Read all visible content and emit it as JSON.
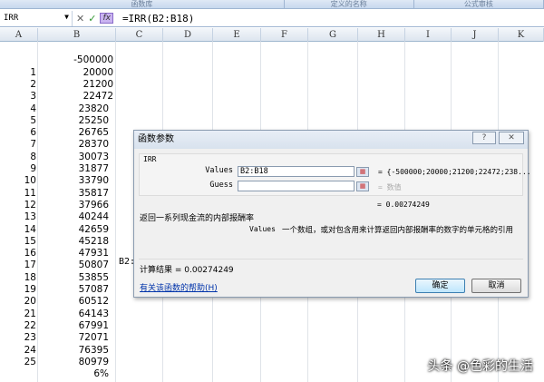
{
  "ribbon": {
    "groups": [
      "函数库",
      "定义的名称",
      "公式审核"
    ]
  },
  "formula_bar": {
    "name_box": "IRR",
    "formula": "=IRR(B2:B18)",
    "fx": "fx",
    "cancel": "✕",
    "enter": "✓"
  },
  "columns": [
    "A",
    "B",
    "C",
    "D",
    "E",
    "F",
    "G",
    "H",
    "I",
    "J",
    "K"
  ],
  "rows": [
    {
      "a": "",
      "b": ""
    },
    {
      "a": "",
      "b": "-500000"
    },
    {
      "a": "1",
      "b": "20000"
    },
    {
      "a": "2",
      "b": "21200"
    },
    {
      "a": "3",
      "b": "22472"
    },
    {
      "a": "4",
      "b": "23820"
    },
    {
      "a": "5",
      "b": "25250"
    },
    {
      "a": "6",
      "b": "26765"
    },
    {
      "a": "7",
      "b": "28370"
    },
    {
      "a": "8",
      "b": "30073"
    },
    {
      "a": "9",
      "b": "31877"
    },
    {
      "a": "10",
      "b": "33790"
    },
    {
      "a": "11",
      "b": "35817"
    },
    {
      "a": "12",
      "b": "37966"
    },
    {
      "a": "13",
      "b": "40244"
    },
    {
      "a": "14",
      "b": "42659"
    },
    {
      "a": "15",
      "b": "45218"
    },
    {
      "a": "16",
      "b": "47931"
    },
    {
      "a": "17",
      "b": "50807"
    },
    {
      "a": "18",
      "b": "53855"
    },
    {
      "a": "19",
      "b": "57087"
    },
    {
      "a": "20",
      "b": "60512"
    },
    {
      "a": "21",
      "b": "64143"
    },
    {
      "a": "22",
      "b": "67991"
    },
    {
      "a": "23",
      "b": "72071"
    },
    {
      "a": "24",
      "b": "76395"
    },
    {
      "a": "25",
      "b": "80979"
    },
    {
      "a": "",
      "b": "6%"
    }
  ],
  "peek_text": "B2:",
  "dialog": {
    "title": "函数参数",
    "help_btn": "?",
    "close_btn": "✕",
    "function_name": "IRR",
    "values_label": "Values",
    "values_input": "B2:B18",
    "values_result": "= {-500000;20000;21200;22472;238...",
    "guess_label": "Guess",
    "guess_input": "",
    "guess_result": "= 数值",
    "formula_result": "= 0.00274249",
    "description": "返回一系列现金流的内部报酬率",
    "arg_name": "Values",
    "arg_description": "一个数组，或对包含用来计算返回内部报酬率的数字的单元格的引用",
    "calc_result": "计算结果 =  0.00274249",
    "help_link": "有关该函数的帮助(H)",
    "ok": "确定",
    "cancel": "取消"
  },
  "watermark": "头条 @色彩的生活"
}
